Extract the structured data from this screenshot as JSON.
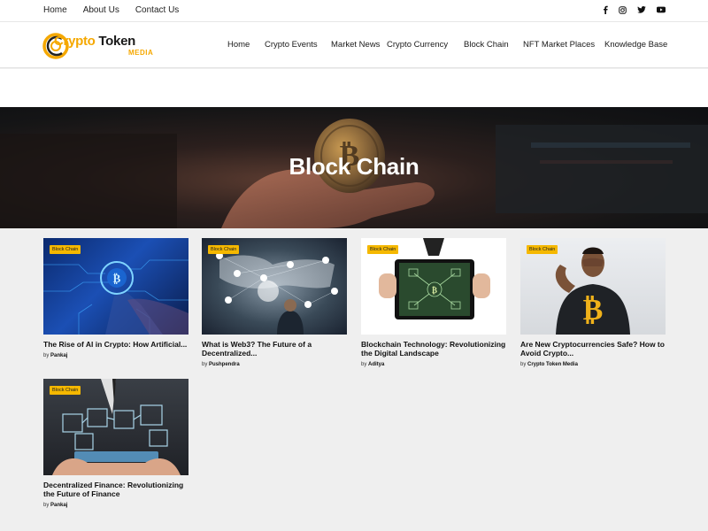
{
  "topbar": {
    "links": [
      "Home",
      "About Us",
      "Contact Us"
    ],
    "social_icons": [
      "facebook-icon",
      "instagram-icon",
      "twitter-icon",
      "youtube-icon"
    ]
  },
  "logo": {
    "word_start": "Crypto",
    "word_end": "Token",
    "sub": "MEDIA"
  },
  "nav": {
    "items": [
      "Home",
      "Crypto Events",
      "Market News",
      "Crypto Currency",
      "Block Chain",
      "NFT Market Places",
      "Knowledge Base"
    ]
  },
  "hero": {
    "title": "Block Chain"
  },
  "colors": {
    "accent": "#f5b800",
    "brand": "#f5a800"
  },
  "posts": [
    {
      "category": "Block Chain",
      "title": "The Rise of AI in Crypto: How Artificial...",
      "by": "by",
      "author": "Pankaj"
    },
    {
      "category": "Block Chain",
      "title": "What is Web3? The Future of a Decentralized...",
      "by": "by",
      "author": "Pushpendra"
    },
    {
      "category": "Block Chain",
      "title": "Blockchain Technology: Revolutionizing the Digital Landscape",
      "by": "by",
      "author": "Aditya"
    },
    {
      "category": "Block Chain",
      "title": "Are New Cryptocurrencies Safe? How to Avoid Crypto...",
      "by": "by",
      "author": "Crypto Token Media"
    },
    {
      "category": "Block Chain",
      "title": "Decentralized Finance: Revolutionizing the Future of Finance",
      "by": "by",
      "author": "Pankaj"
    }
  ]
}
